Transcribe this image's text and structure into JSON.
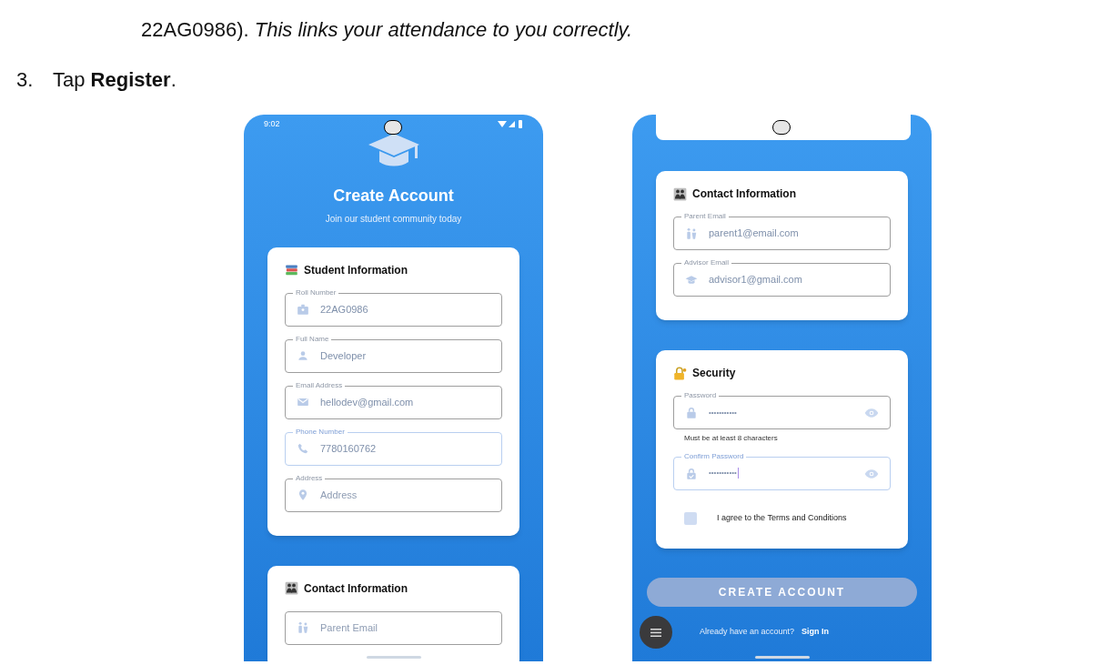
{
  "document": {
    "lines": [
      {
        "kind": "continuation",
        "text": "22AG0986). *This links your attendance to you correctly.*"
      },
      {
        "kind": "step",
        "number": "3.",
        "text": "Tap **Register**."
      }
    ]
  },
  "screens": [
    {
      "status_time": "9:02",
      "header": {
        "title": "Create Account",
        "subtitle": "Join our student community today"
      },
      "sections": [
        {
          "title": "Student Information",
          "fields": [
            {
              "kind": "text",
              "label": "Roll Number",
              "value": "22AG0986",
              "focused": false
            },
            {
              "kind": "text",
              "label": "Full Name",
              "value": "Developer",
              "focused": false
            },
            {
              "kind": "text",
              "label": "Email Address",
              "value": "hellodev@gmail.com",
              "focused": false
            },
            {
              "kind": "text",
              "label": "Phone Number",
              "value": "7780160762",
              "focused": true
            },
            {
              "kind": "text",
              "label": "Address",
              "placeholder": "Address",
              "focused": false
            }
          ]
        },
        {
          "title": "Contact Information",
          "fields": [
            {
              "kind": "text",
              "placeholder": "Parent Email",
              "focused": false
            }
          ]
        }
      ]
    },
    {
      "sections": [
        {
          "title": "Contact Information",
          "fields": [
            {
              "kind": "text",
              "label": "Parent Email",
              "value": "parent1@email.com",
              "focused": false
            },
            {
              "kind": "text",
              "label": "Advisor Email",
              "value": "advisor1@gmail.com",
              "focused": false
            }
          ]
        },
        {
          "title": "Security",
          "fields": [
            {
              "kind": "password",
              "label": "Password",
              "value": "•••••••••••",
              "focused": false,
              "helper": "Must be at least 8 characters"
            },
            {
              "kind": "password",
              "label": "Confirm Password",
              "value": "•••••••••••",
              "focused": true
            }
          ],
          "agreement": {
            "label": "I agree to the Terms and Conditions",
            "checked": false
          }
        }
      ],
      "submit": {
        "label": "CREATE ACCOUNT",
        "disabled": true
      },
      "footer": {
        "text": "Already have an account?",
        "link": "Sign In"
      }
    }
  ]
}
